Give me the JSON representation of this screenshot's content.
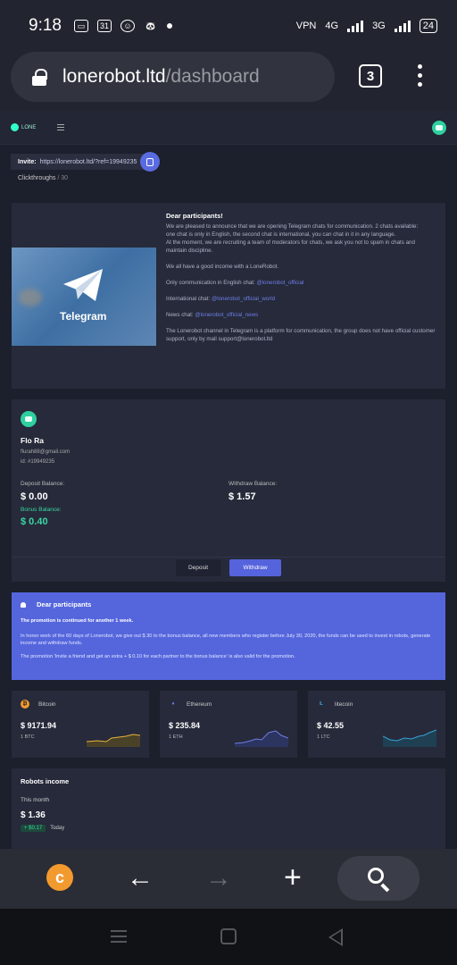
{
  "status_bar": {
    "time": "9:18",
    "calendar_day": "31",
    "battery": "24",
    "network_1": "4G",
    "network_2": "3G",
    "vpn": "VPN"
  },
  "browser": {
    "url_host": "lonerobot.ltd",
    "url_path": "/dashboard",
    "tab_count": "3"
  },
  "site": {
    "logo_text": "LONE"
  },
  "invite": {
    "label": "Invite:",
    "url": "https://lonerobot.ltd/?ref=19949235",
    "clicks_label": "Clickthroughs",
    "clicks_sep": "/",
    "clicks_value": "30"
  },
  "announcement": {
    "image_label": "Telegram",
    "title": "Dear participants!",
    "p1": "We are pleased to announce that we are opening Telegram chats for communication. 2 chats available:",
    "p1b": "one chat is only in English, the second chat is international, you can chat in it in any language.",
    "p1c": "At the moment, we are recruiting a team of moderators for chats, we ask you not to spam in chats and maintain discipline.",
    "p2": "We all have a good income with a LoneRobot.",
    "p3_prefix": "Only communication in English chat:",
    "p3_link": "@lonerobot_official",
    "p4_prefix": "International chat:",
    "p4_link": "@lonerobot_official_world",
    "p5_prefix": "News chat:",
    "p5_link": "@lonerobot_official_news",
    "p6": "The Lonerobot channel in Telegram is a platform for communication, the group does not have official customer support, only by mail support@lonerobot.ltd"
  },
  "profile": {
    "name": "Flo Ra",
    "email": "flurah88@gmail.com",
    "id": "id: #19949235",
    "deposit_label": "Deposit Balance:",
    "deposit_value": "$ 0.00",
    "withdraw_label": "Withdraw Balance:",
    "withdraw_value": "$ 1.57",
    "bonus_label": "Bonus Balance:",
    "bonus_value": "$ 0.40",
    "deposit_btn": "Deposit",
    "withdraw_btn": "Withdraw"
  },
  "promo": {
    "title": "Dear participants",
    "bold": "The promotion is continued for another 1 week.",
    "p1": "In honor work of the 60 days of Lonerobot, we give out $ 30 to the bonus balance, all new members who register before July 30, 2020, the funds can be used to invest in robots, generate income and withdraw funds.",
    "p2": "The promotion 'Invite a friend and get an extra + $ 0.10 for each partner to the bonus balance' is also valid for the promotion."
  },
  "coins": [
    {
      "name": "Bitcoin",
      "symbol": "₿",
      "price": "$ 9171.94",
      "unit": "1 BTC",
      "color": "#f29a2e"
    },
    {
      "name": "Ethereum",
      "symbol": "♦",
      "price": "$ 235.84",
      "unit": "1 ETH",
      "color": "#6f7de6"
    },
    {
      "name": "litecoin",
      "symbol": "Ł",
      "price": "$ 42.55",
      "unit": "1 LTC",
      "color": "#3aa0d8"
    }
  ],
  "income": {
    "title": "Robots income",
    "period_label": "This month",
    "value": "$ 1.36",
    "today_badge": "+ $0.17",
    "today_label": "Today"
  },
  "colors": {
    "accent": "#5563dc",
    "bonus": "#3bd6a2",
    "card": "#262a3a",
    "bg": "#1c1f2c"
  },
  "icons": [
    "lock-icon",
    "menu-dots-icon",
    "copy-icon",
    "telegram-plane-icon",
    "bell-icon",
    "robot-avatar-icon",
    "search-icon",
    "back-arrow-icon",
    "forward-arrow-icon",
    "plus-icon"
  ]
}
